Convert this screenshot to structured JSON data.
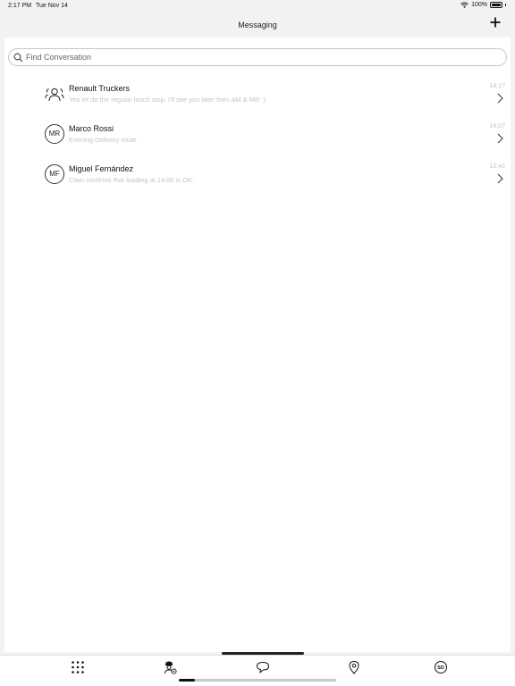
{
  "status_bar": {
    "time": "2:17 PM",
    "date": "Tue Nov 14",
    "battery": "100%"
  },
  "header": {
    "title": "Messaging",
    "add_icon": "plus-icon"
  },
  "search": {
    "placeholder": "Find Conversation",
    "value": ""
  },
  "conversations": [
    {
      "name": "Renault Truckers",
      "preview": "Yes let do the regular lunch stop. I'll see you later then AM & MR :)",
      "time": "14:17",
      "avatar": "group-icon",
      "initials": ""
    },
    {
      "name": "Marco Rossi",
      "preview": "Evening Delivery route",
      "time": "14:07",
      "avatar": "initials",
      "initials": "MR"
    },
    {
      "name": "Miguel Fernández",
      "preview": "Clain confirms that loading at 14.00 is OK.",
      "time": "12:42",
      "avatar": "initials",
      "initials": "MF"
    }
  ],
  "tab_bar": {
    "tabs": [
      "apps-grid-icon",
      "driver-icon",
      "chat-bubble-icon",
      "location-pin-icon",
      "sd-icon"
    ],
    "sd_label": "SD"
  },
  "colors": {
    "background": "#f2f2f2",
    "content": "#ffffff",
    "muted_text": "#c4c4c4"
  }
}
